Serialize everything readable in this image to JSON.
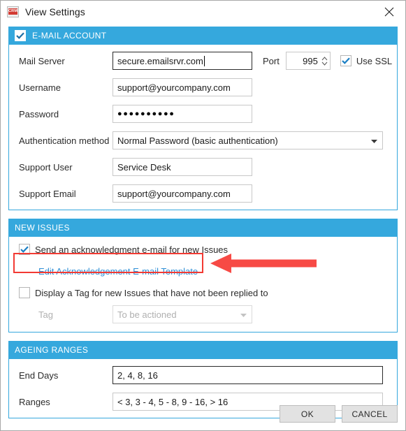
{
  "window": {
    "title": "View Settings",
    "icon": "crm-app-icon",
    "icon_text": "CRM",
    "close_label": "×"
  },
  "sections": {
    "email_account": {
      "header": "E-MAIL ACCOUNT",
      "checked": true,
      "fields": {
        "mail_server_label": "Mail Server",
        "mail_server_value": "secure.emailsrvr.com",
        "port_label": "Port",
        "port_value": "995",
        "use_ssl_label": "Use SSL",
        "use_ssl_checked": true,
        "username_label": "Username",
        "username_value": "support@yourcompany.com",
        "password_label": "Password",
        "password_value": "●●●●●●●●●●",
        "auth_label": "Authentication method",
        "auth_value": "Normal Password (basic authentication)",
        "support_user_label": "Support User",
        "support_user_value": "Service Desk",
        "support_email_label": "Support Email",
        "support_email_value": "support@yourcompany.com"
      }
    },
    "new_issues": {
      "header": "NEW ISSUES",
      "ack_checkbox_label": "Send an acknowledgment e-mail for new Issues",
      "ack_checked": true,
      "edit_template_link": "Edit Acknowledgement E-mail Template",
      "tag_checkbox_label": "Display a Tag for new Issues that have not been replied to",
      "tag_checked": false,
      "tag_label": "Tag",
      "tag_value": "To be actioned",
      "tag_disabled": true
    },
    "ageing_ranges": {
      "header": "AGEING RANGES",
      "end_days_label": "End Days",
      "end_days_value": "2, 4, 8, 16",
      "ranges_label": "Ranges",
      "ranges_value": "< 3, 3 - 4, 5 - 8, 9 - 16, > 16"
    }
  },
  "footer": {
    "ok_label": "OK",
    "cancel_label": "CANCEL"
  },
  "annotation": {
    "highlight_color": "#f23a33",
    "arrow_direction": "left",
    "target": "Edit Acknowledgement E-mail Template"
  },
  "colors": {
    "accent": "#35a8dd",
    "link": "#2e8fd6",
    "annotation": "#f23a33",
    "button_bg": "#e2e2e2"
  }
}
